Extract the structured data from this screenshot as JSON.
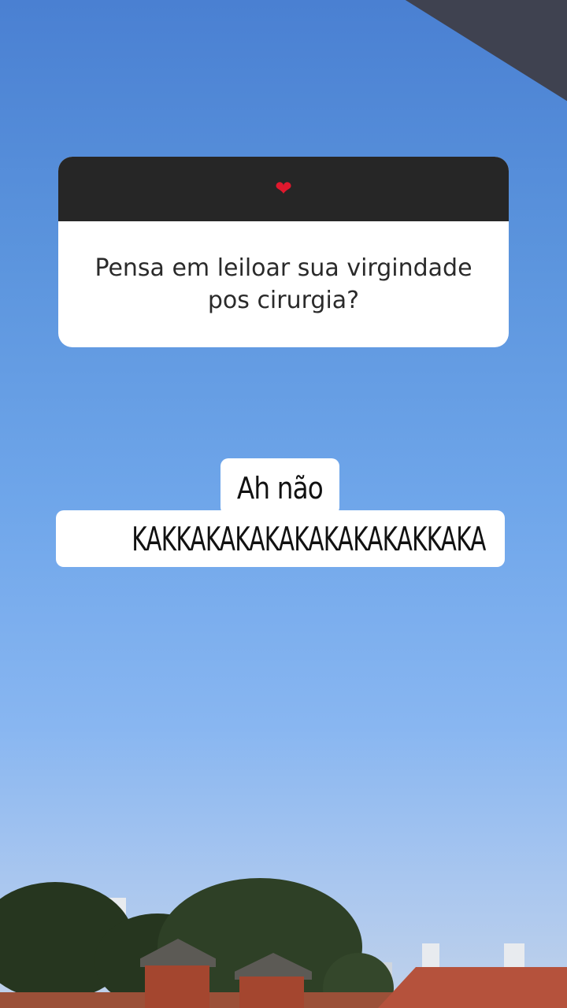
{
  "question_sticker": {
    "header_icon": "heart-icon",
    "header_icon_color": "#e0182d",
    "question_text": "Pensa em leiloar sua virgindade pos cirurgia?"
  },
  "answer": {
    "line1": "Ah não",
    "line2": "KAKKAKAKAKAKAKAKAKAKKAKA"
  },
  "colors": {
    "sticker_header": "#262626",
    "sky_top": "#4a80d2",
    "sky_bottom": "#c1d2ea"
  }
}
